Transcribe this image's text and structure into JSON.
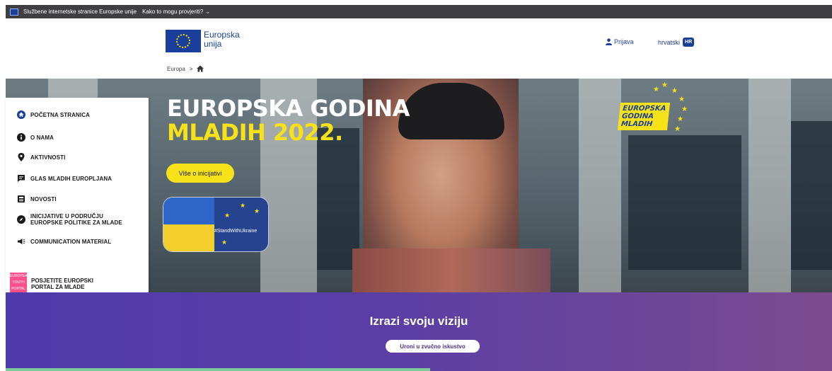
{
  "top_banner": {
    "official_text": "Službene internetske stranice Europske unije",
    "verify_text": "Kako to mogu provjeriti?"
  },
  "header": {
    "site_name_line1": "Europska",
    "site_name_line2": "unija",
    "login_label": "Prijava",
    "language_label": "hrvatski",
    "language_code": "HR"
  },
  "breadcrumb": {
    "europa": "Europa",
    "separator": ">"
  },
  "hero": {
    "title_line1": "EUROPSKA GODINA",
    "title_line2": "MLADIH 2022.",
    "button_label": "Više o inicijativi",
    "ukraine_tag": "#StandWithUkraine",
    "badge_line1": "EUROPSKA",
    "badge_line2": "GODINA",
    "badge_line3": "MLADIH",
    "accent_color": "#f7e21a"
  },
  "sidebar": {
    "items": [
      {
        "label": "POČETNA STRANICA",
        "icon": "home-icon"
      },
      {
        "label": "O NAMA",
        "icon": "info-icon"
      },
      {
        "label": "AKTIVNOSTI",
        "icon": "location-pin-icon"
      },
      {
        "label": "GLAS MLADIH EUROPLJANA",
        "icon": "chat-icon"
      },
      {
        "label": "NOVOSTI",
        "icon": "newspaper-icon"
      },
      {
        "label_line1": "INICIJATIVE U PODRUČJU",
        "label_line2": "EUROPSKE POLITIKE ZA MLADE",
        "icon": "compass-icon"
      },
      {
        "label": "COMMUNICATION MATERIAL",
        "icon": "megaphone-icon"
      }
    ],
    "portal_line1": "POSJETITE EUROPSKI",
    "portal_line2": "PORTAL ZA MLADE",
    "portal_logo_lines": [
      "EUROPEAN",
      "YOUTH",
      "PORTAL"
    ]
  },
  "promo": {
    "title": "Izrazi svoju viziju",
    "button_label": "Uroni u zvučno iskustvo"
  }
}
